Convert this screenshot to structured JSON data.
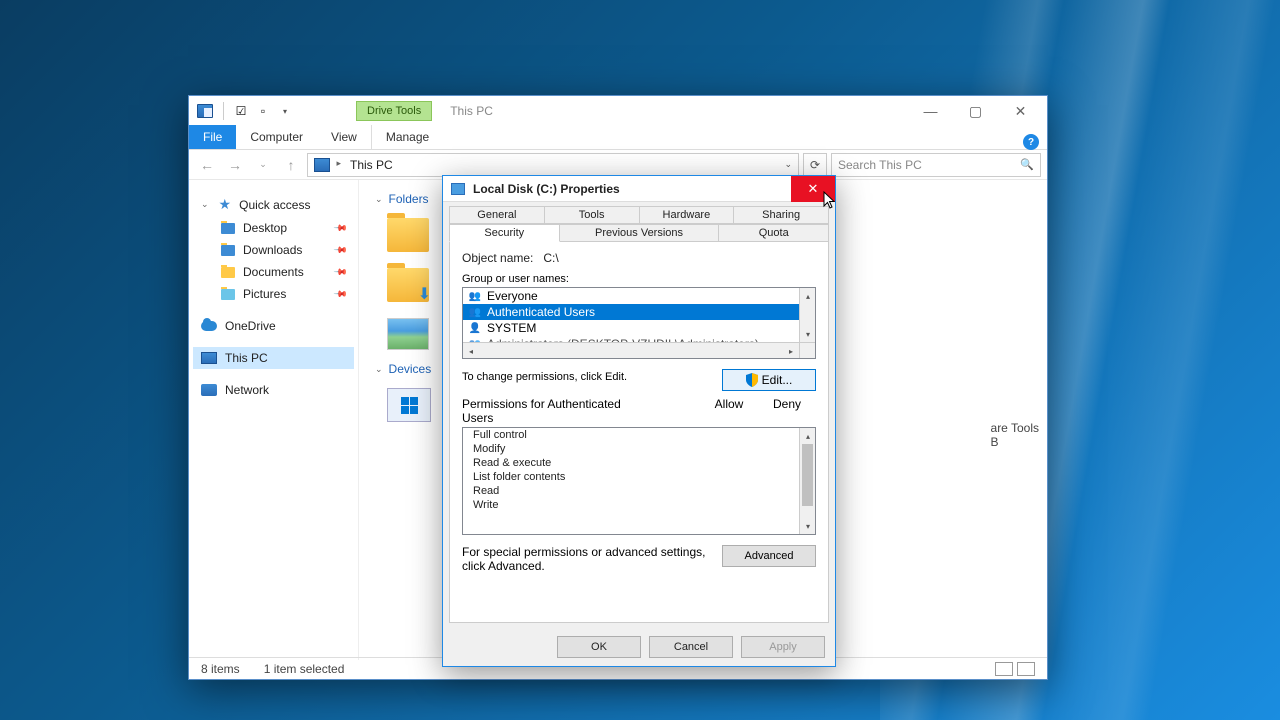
{
  "explorer": {
    "drive_tools_tab": "Drive Tools",
    "title": "This PC",
    "menu": {
      "file": "File",
      "computer": "Computer",
      "view": "View",
      "manage": "Manage"
    },
    "breadcrumb": "This PC",
    "search_placeholder": "Search This PC",
    "nav": {
      "quick_access": "Quick access",
      "desktop": "Desktop",
      "downloads": "Downloads",
      "documents": "Documents",
      "pictures": "Pictures",
      "onedrive": "OneDrive",
      "this_pc": "This PC",
      "network": "Network"
    },
    "groups": {
      "folders": "Folders",
      "devices": "Devices"
    },
    "right_snippet_line1": "are Tools",
    "right_snippet_line2": "B",
    "status": {
      "items": "8 items",
      "selected": "1 item selected"
    }
  },
  "props": {
    "title": "Local Disk (C:) Properties",
    "tabs_row1": [
      "General",
      "Tools",
      "Hardware",
      "Sharing"
    ],
    "tabs_row2": [
      "Security",
      "Previous Versions",
      "Quota"
    ],
    "object_label": "Object name:",
    "object_value": "C:\\",
    "group_label": "Group or user names:",
    "users": [
      "Everyone",
      "Authenticated Users",
      "SYSTEM",
      "Administrators (DESKTOP-VZUDIL\\Administrators)"
    ],
    "selected_user_index": 1,
    "change_hint": "To change permissions, click Edit.",
    "edit_btn": "Edit...",
    "perm_label_prefix": "Permissions for Authenticated",
    "perm_label_suffix": "Users",
    "allow": "Allow",
    "deny": "Deny",
    "permissions": [
      "Full control",
      "Modify",
      "Read & execute",
      "List folder contents",
      "Read",
      "Write"
    ],
    "adv_hint": "For special permissions or advanced settings, click Advanced.",
    "adv_btn": "Advanced",
    "buttons": {
      "ok": "OK",
      "cancel": "Cancel",
      "apply": "Apply"
    }
  }
}
